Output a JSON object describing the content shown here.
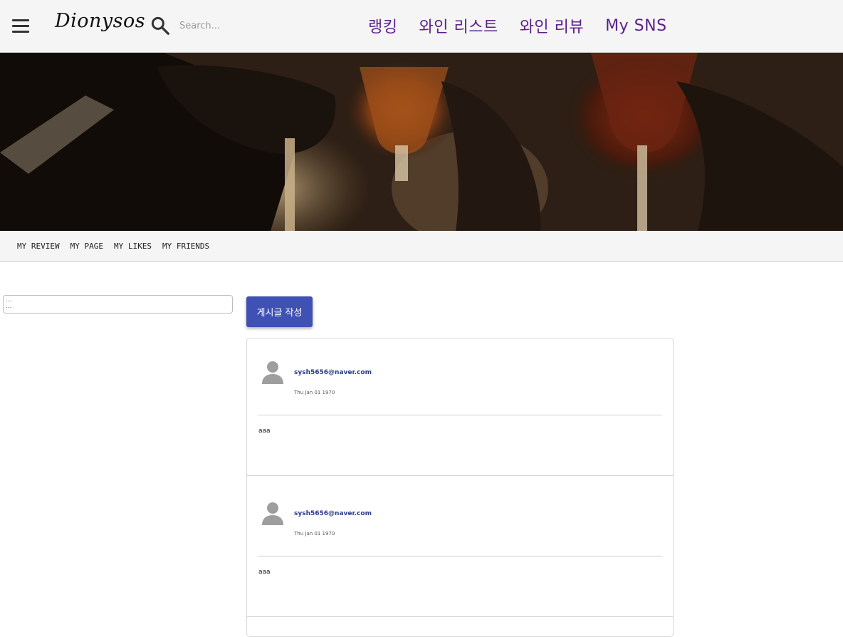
{
  "header": {
    "brand": "Dionysos",
    "search": {
      "placeholder": "Search..."
    },
    "nav": [
      {
        "label": "랭킹"
      },
      {
        "label": "와인 리스트"
      },
      {
        "label": "와인 리뷰"
      },
      {
        "label": "My SNS"
      }
    ],
    "nav_color": "#5b1f8a"
  },
  "subtabs": [
    {
      "label": "My Review"
    },
    {
      "label": "My Page"
    },
    {
      "label": "My Likes"
    },
    {
      "label": "My Friends"
    }
  ],
  "sidebar": {
    "filter_text_1": "...",
    "filter_text_2": "..."
  },
  "main": {
    "write_button": "게시글 작성",
    "accent": "#3f51b5",
    "posts": [
      {
        "author": "sysh5656@naver.com",
        "date": "Thu Jan 01 1970",
        "body": "aaa"
      },
      {
        "author": "sysh5656@naver.com",
        "date": "Thu Jan 01 1970",
        "body": "aaa"
      }
    ]
  }
}
